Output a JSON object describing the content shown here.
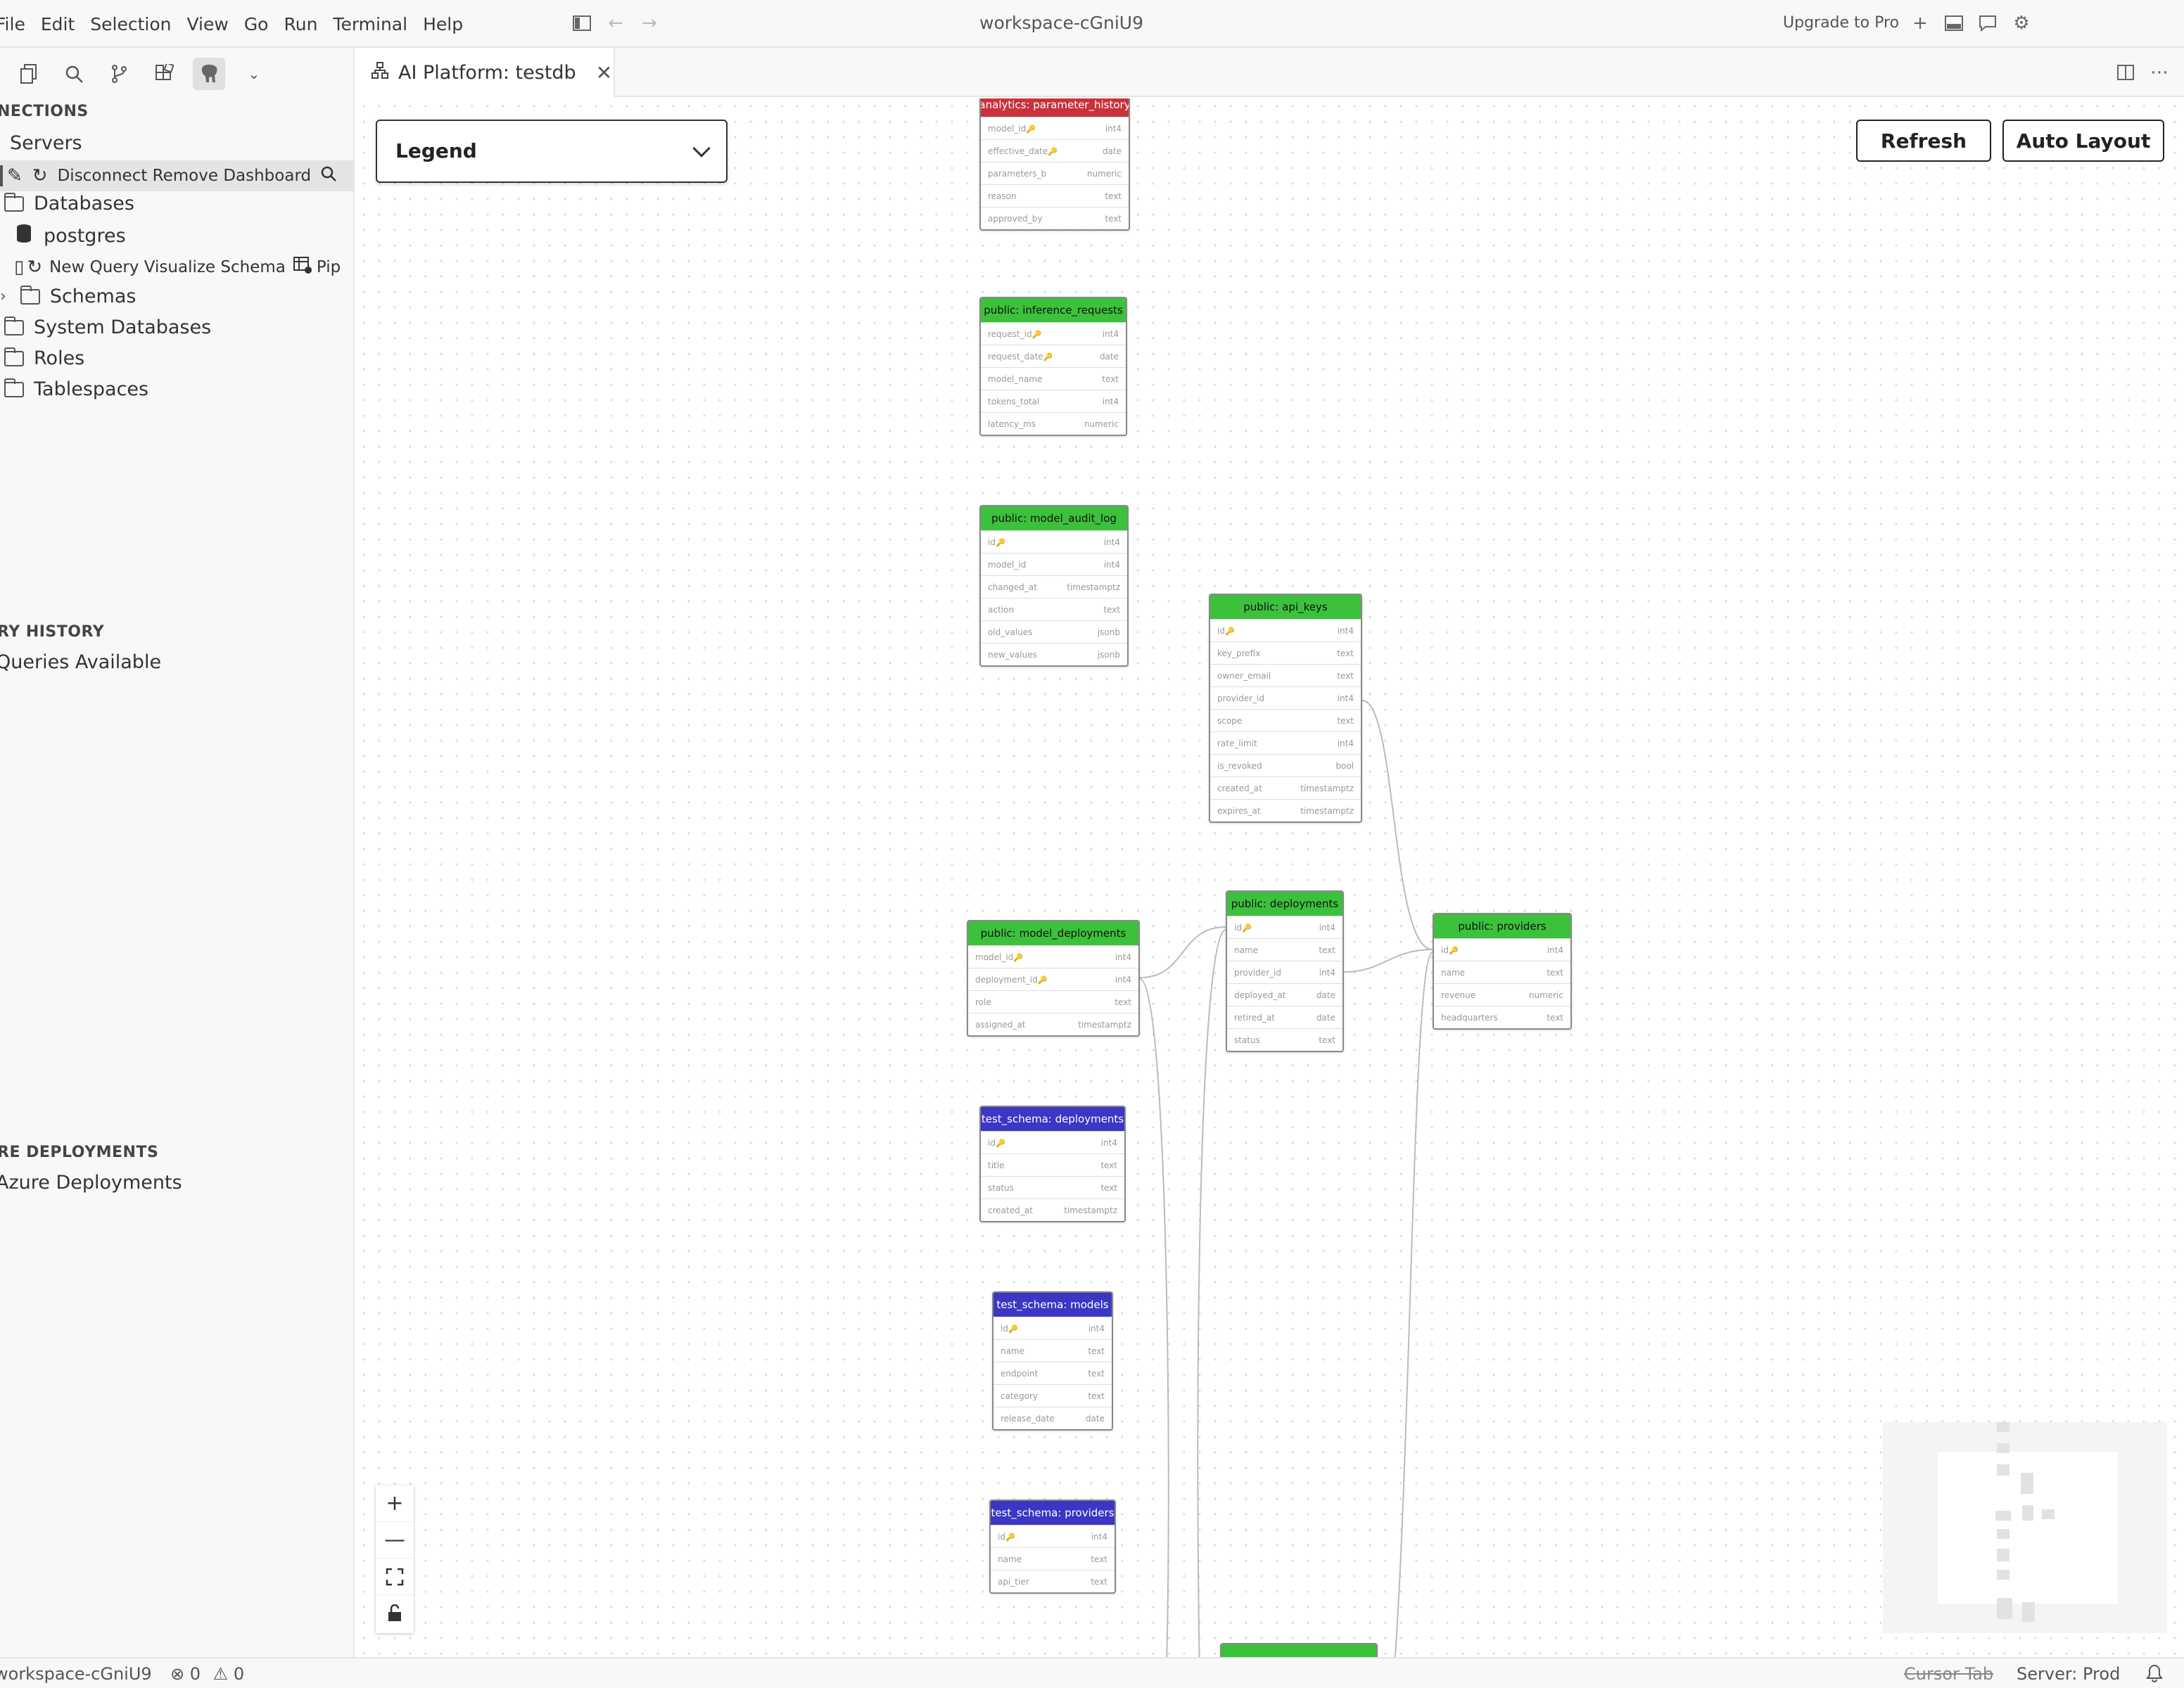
{
  "menu": [
    "File",
    "Edit",
    "Selection",
    "View",
    "Go",
    "Run",
    "Terminal",
    "Help"
  ],
  "window_title": "workspace-cGniU9",
  "upgrade_label": "Upgrade to Pro",
  "sidebar": {
    "connections_header": "NECTIONS",
    "servers": "Servers",
    "server_actions": "Disconnect Remove Dashboard",
    "databases": "Databases",
    "postgres": "postgres",
    "db_actions": "New Query Visualize Schema",
    "db_actions_more": "Pip",
    "schemas": "Schemas",
    "system_databases": "System Databases",
    "roles": "Roles",
    "tablespaces": "Tablespaces",
    "history_header": "RY HISTORY",
    "history_empty": "Queries Available",
    "deployments_header": "RE DEPLOYMENTS",
    "deployments_empty": "Azure Deployments"
  },
  "tab": {
    "label": "AI Platform: testdb"
  },
  "canvas": {
    "legend_label": "Legend",
    "refresh_label": "Refresh",
    "auto_layout_label": "Auto Layout",
    "zoom": {
      "plus": "+",
      "minus": "—"
    }
  },
  "tables": [
    {
      "title": "analytics: parameter_history",
      "color": "#c8323c",
      "rows": [
        [
          "model_id",
          "int4",
          true
        ],
        [
          "effective_date",
          "date",
          true
        ],
        [
          "parameters_b",
          "numeric",
          false
        ],
        [
          "reason",
          "text",
          false
        ],
        [
          "approved_by",
          "text",
          false
        ]
      ]
    },
    {
      "title": "public: inference_requests",
      "color": "#3cc13c",
      "rows": [
        [
          "request_id",
          "int4",
          true
        ],
        [
          "request_date",
          "date",
          true
        ],
        [
          "model_name",
          "text",
          false
        ],
        [
          "tokens_total",
          "int4",
          false
        ],
        [
          "latency_ms",
          "numeric",
          false
        ]
      ]
    },
    {
      "title": "public: model_audit_log",
      "color": "#3cc13c",
      "rows": [
        [
          "id",
          "int4",
          true
        ],
        [
          "model_id",
          "int4",
          false
        ],
        [
          "changed_at",
          "timestamptz",
          false
        ],
        [
          "action",
          "text",
          false
        ],
        [
          "old_values",
          "jsonb",
          false
        ],
        [
          "new_values",
          "jsonb",
          false
        ]
      ]
    },
    {
      "title": "public: api_keys",
      "color": "#3cc13c",
      "rows": [
        [
          "id",
          "int4",
          true
        ],
        [
          "key_prefix",
          "text",
          false
        ],
        [
          "owner_email",
          "text",
          false
        ],
        [
          "provider_id",
          "int4",
          false
        ],
        [
          "scope",
          "text",
          false
        ],
        [
          "rate_limit",
          "int4",
          false
        ],
        [
          "is_revoked",
          "bool",
          false
        ],
        [
          "created_at",
          "timestamptz",
          false
        ],
        [
          "expires_at",
          "timestamptz",
          false
        ]
      ]
    },
    {
      "title": "public: deployments",
      "color": "#3cc13c",
      "rows": [
        [
          "id",
          "int4",
          true
        ],
        [
          "name",
          "text",
          false
        ],
        [
          "provider_id",
          "int4",
          false
        ],
        [
          "deployed_at",
          "date",
          false
        ],
        [
          "retired_at",
          "date",
          false
        ],
        [
          "status",
          "text",
          false
        ]
      ]
    },
    {
      "title": "public: providers",
      "color": "#3cc13c",
      "rows": [
        [
          "id",
          "int4",
          true
        ],
        [
          "name",
          "text",
          false
        ],
        [
          "revenue",
          "numeric",
          false
        ],
        [
          "headquarters",
          "text",
          false
        ]
      ]
    },
    {
      "title": "public: model_deployments",
      "color": "#3cc13c",
      "rows": [
        [
          "model_id",
          "int4",
          true
        ],
        [
          "deployment_id",
          "int4",
          true
        ],
        [
          "role",
          "text",
          false
        ],
        [
          "assigned_at",
          "timestamptz",
          false
        ]
      ]
    },
    {
      "title": "test_schema: deployments",
      "color": "#3b36c4",
      "rows": [
        [
          "id",
          "int4",
          true
        ],
        [
          "title",
          "text",
          false
        ],
        [
          "status",
          "text",
          false
        ],
        [
          "created_at",
          "timestamptz",
          false
        ]
      ]
    },
    {
      "title": "test_schema: models",
      "color": "#3b36c4",
      "rows": [
        [
          "id",
          "int4",
          true
        ],
        [
          "name",
          "text",
          false
        ],
        [
          "endpoint",
          "text",
          false
        ],
        [
          "category",
          "text",
          false
        ],
        [
          "release_date",
          "date",
          false
        ]
      ]
    },
    {
      "title": "test_schema: providers",
      "color": "#3b36c4",
      "rows": [
        [
          "id",
          "int4",
          true
        ],
        [
          "name",
          "text",
          false
        ],
        [
          "api_tier",
          "text",
          false
        ]
      ]
    }
  ],
  "statusbar": {
    "workspace": "workspace-cGniU9",
    "problems": "0",
    "warnings": "0",
    "cursor_tab": "Cursor Tab",
    "server": "Server: Prod"
  }
}
